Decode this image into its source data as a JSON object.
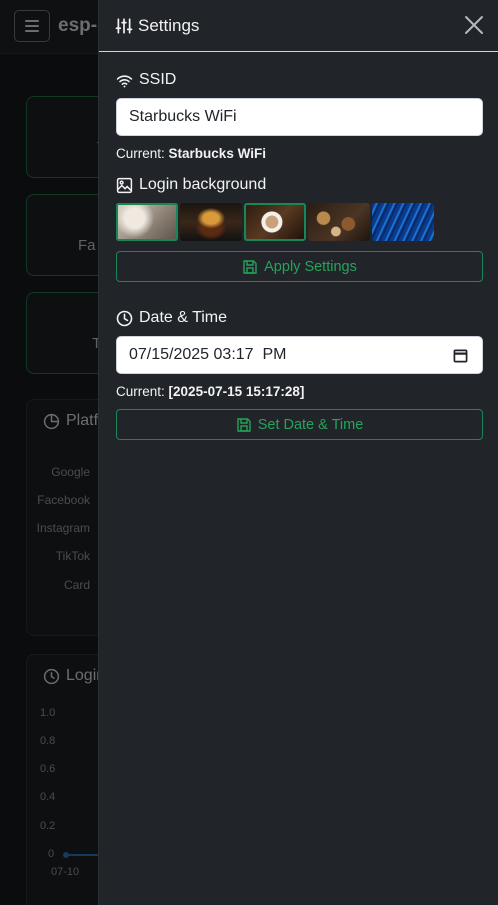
{
  "background_app": {
    "brand": "esp-",
    "cards": [
      {
        "label": "T"
      },
      {
        "label": "Fa"
      },
      {
        "label": "T"
      }
    ],
    "platforms_panel": {
      "title": "Platf",
      "rows": [
        "Google",
        "Facebook",
        "Instagram",
        "TikTok",
        "Card"
      ]
    },
    "logins_panel": {
      "title": "Login",
      "y_ticks": [
        "1.0",
        "0.8",
        "0.6",
        "0.4",
        "0.2",
        "0"
      ],
      "x_ticks": [
        "07-10"
      ]
    }
  },
  "drawer": {
    "title": "Settings",
    "ssid": {
      "label": "SSID",
      "value": "Starbucks WiFi",
      "current_prefix": "Current:",
      "current_value": "Starbucks WiFi"
    },
    "background": {
      "label": "Login background",
      "thumbnails": [
        {
          "name": "wedding-thumb",
          "selected": true
        },
        {
          "name": "burger-thumb",
          "selected": false
        },
        {
          "name": "coffee-thumb",
          "selected": true
        },
        {
          "name": "pastries-thumb",
          "selected": false
        },
        {
          "name": "fiber-optic-thumb",
          "selected": false
        }
      ],
      "apply_label": "Apply Settings"
    },
    "datetime": {
      "label": "Date & Time",
      "value": "07/15/2025 03:17  PM",
      "current_prefix": "Current:",
      "current_value": "[2025-07-15 15:17:28]",
      "set_label": "Set Date & Time"
    }
  },
  "colors": {
    "accent": "#198754",
    "drawer_bg": "#212529"
  }
}
